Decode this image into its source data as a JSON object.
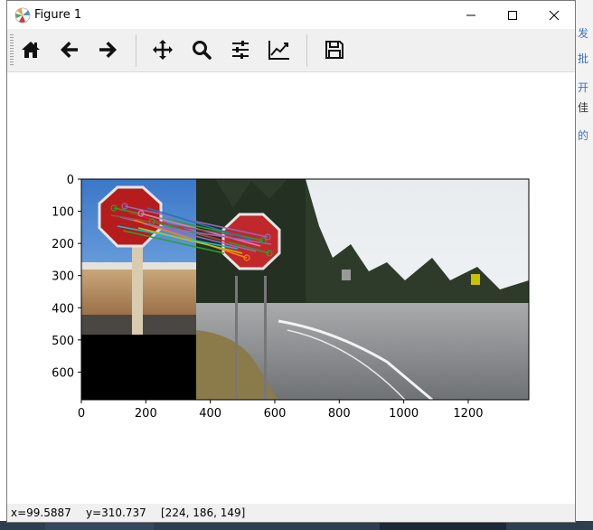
{
  "window": {
    "title": "Figure 1",
    "minimize_icon": "minimize-icon",
    "maximize_icon": "maximize-icon",
    "close_icon": "close-icon"
  },
  "toolbar": {
    "buttons": [
      {
        "name": "home-button",
        "icon": "home-icon"
      },
      {
        "name": "back-button",
        "icon": "arrow-left-icon"
      },
      {
        "name": "forward-button",
        "icon": "arrow-right-icon"
      },
      {
        "name": "pan-button",
        "icon": "move-icon"
      },
      {
        "name": "zoom-button",
        "icon": "magnifier-icon"
      },
      {
        "name": "configure-subplots-button",
        "icon": "sliders-icon"
      },
      {
        "name": "edit-axis-button",
        "icon": "line-chart-icon"
      },
      {
        "name": "save-button",
        "icon": "floppy-disk-icon"
      }
    ]
  },
  "plot": {
    "x_ticks": [
      "0",
      "200",
      "400",
      "600",
      "800",
      "1000",
      "1200"
    ],
    "y_ticks": [
      "0",
      "100",
      "200",
      "300",
      "400",
      "500",
      "600"
    ],
    "xlim": [
      0,
      1388
    ],
    "ylim": [
      686,
      0
    ],
    "image_description_source": "feature matching of stop sign",
    "match_colors": [
      "#2ca02c",
      "#9467bd",
      "#ff7f0e",
      "#e377c2",
      "#1f77b4",
      "#17becf"
    ]
  },
  "status": {
    "x": "x=99.5887",
    "y": "y=310.737",
    "pixel": "[224, 186, 149]"
  },
  "background": {
    "links": [
      "发",
      "批",
      "开",
      "佳",
      "的"
    ]
  }
}
